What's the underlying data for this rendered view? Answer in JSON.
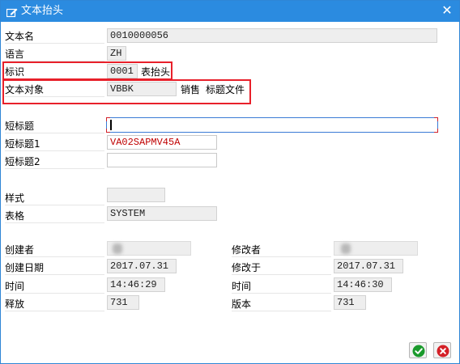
{
  "window": {
    "title": "文本抬头",
    "title_icon": "edit-document-icon",
    "close_icon": "close-icon"
  },
  "fields": {
    "text_name": {
      "label": "文本名",
      "value": "0010000056"
    },
    "language": {
      "label": "语言",
      "value": "ZH"
    },
    "id": {
      "label": "标识",
      "value": "0001",
      "desc": "表抬头"
    },
    "text_object": {
      "label": "文本对象",
      "value": "VBBK",
      "desc1": "销售",
      "desc2": "标题文件"
    },
    "short_title": {
      "label": "短标题",
      "value": ""
    },
    "short_title1": {
      "label": "短标题1",
      "value": "VA02SAPMV45A"
    },
    "short_title2": {
      "label": "短标题2",
      "value": ""
    },
    "style": {
      "label": "样式",
      "value": ""
    },
    "form": {
      "label": "表格",
      "value": "SYSTEM"
    },
    "created_by": {
      "label": "创建者"
    },
    "created_date": {
      "label": "创建日期",
      "value": "2017.07.31"
    },
    "created_time": {
      "label": "时间",
      "value": "14:46:29"
    },
    "release": {
      "label": "释放",
      "value": "731"
    },
    "changed_by": {
      "label": "修改者"
    },
    "changed_on": {
      "label": "修改于",
      "value": "2017.07.31"
    },
    "changed_time": {
      "label": "时间",
      "value": "14:46:30"
    },
    "version": {
      "label": "版本",
      "value": "731"
    }
  },
  "buttons": {
    "ok_icon": "checkmark-icon",
    "cancel_icon": "cancel-icon"
  },
  "colors": {
    "titlebar": "#2b8be0",
    "highlight": "#e8202a",
    "ok": "#1a9a2c",
    "cancel": "#d42027"
  }
}
